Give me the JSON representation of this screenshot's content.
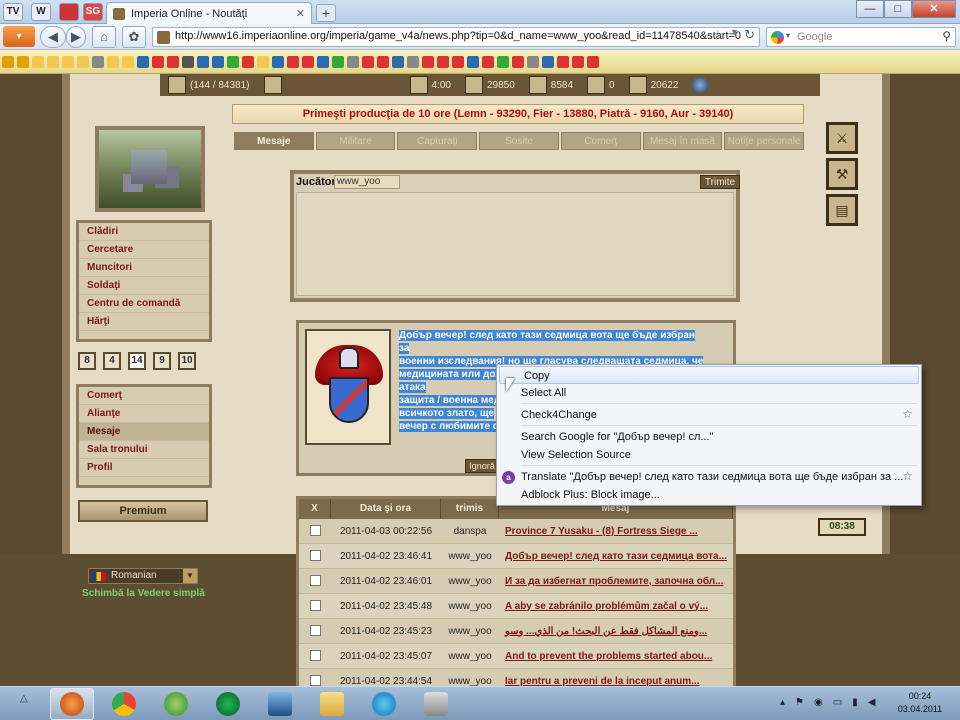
{
  "browser": {
    "pinned_tabs": [
      "TV",
      "W",
      "",
      "SG"
    ],
    "tab_title": "Imperia Online - Noutăţi",
    "new_tab": "+",
    "url": "http://www16.imperiaonline.org/imperia/game_v4a/news.php?tip=0&d_name=www_yoo&read_id=11478540&start=0",
    "search_placeholder": "Google",
    "window_controls": {
      "min": "—",
      "max": "□",
      "close": "✕"
    }
  },
  "game": {
    "resources": {
      "population": "(144 / 84381)",
      "time": "4:00",
      "r1": "29850",
      "r2": "8584",
      "r3": "0",
      "r4": "20622"
    },
    "production_banner": "Primeşti producţia de 10 ore (Lemn - 93290, Fier - 13880, Piatră - 9160, Aur - 39140)",
    "tabs": [
      "Mesaje",
      "Militare",
      "Capturaţi",
      "Sosite",
      "Comerţ",
      "Mesaj în masă",
      "Notiţe personale"
    ],
    "menu_main": [
      "Clădiri",
      "Cercetare",
      "Muncitori",
      "Soldaţi",
      "Centru de comandă",
      "Hărţi"
    ],
    "zoom_levels": [
      "8",
      "4",
      "14",
      "9",
      "10"
    ],
    "menu_secondary": [
      "Comerţ",
      "Alianţe",
      "Mesaje",
      "Sala tronului",
      "Profil"
    ],
    "premium_label": "Premium",
    "language": "Romanian",
    "switch_view": "Schimbă la  Vedere simplă",
    "clock": "08:38",
    "compose": {
      "player_label": "Jucător",
      "player_value": "www_yoo",
      "send_label": "Trimite"
    },
    "message_lines": [
      "Добър вечер! след като тази седмица вота ще бъде избран за",
      "военни изследвания! но ще гласува следващата седмица, че",
      "медицината или доходи! 24:00 след мача! Аз ще разследва атака",
      "защита / военна мед",
      "всичкото злато, ще",
      "вечер с любимите с"
    ],
    "ignore_label": "Ignoră",
    "table": {
      "headers": [
        "X",
        "Data şi ora",
        "trimis",
        "Mesaj"
      ],
      "rows": [
        {
          "date": "2011-04-03 00:22:56",
          "from": "danspa",
          "msg": "Province 7 Yusaku - (8) Fortress Siege ..."
        },
        {
          "date": "2011-04-02 23:46:41",
          "from": "www_yoo",
          "msg": "Добър вечер! след като тази седмица вота..."
        },
        {
          "date": "2011-04-02 23:46:01",
          "from": "www_yoo",
          "msg": "И за да избегнат проблемите, започна обл..."
        },
        {
          "date": "2011-04-02 23:45:48",
          "from": "www_yoo",
          "msg": "A aby se zabránilo problémům začal o vý..."
        },
        {
          "date": "2011-04-02 23:45:23",
          "from": "www_yoo",
          "msg": "ومنع المشاكل فقط عن البحث! من الذي... وسو..."
        },
        {
          "date": "2011-04-02 23:45:07",
          "from": "www_yoo",
          "msg": "And to prevent the problems started abou..."
        },
        {
          "date": "2011-04-02 23:44:54",
          "from": "www_yoo",
          "msg": "Iar pentru a preveni de la inceput anum..."
        }
      ]
    }
  },
  "context_menu": {
    "copy": "Copy",
    "select_all": "Select All",
    "check4change": "Check4Change",
    "search_google": "Search Google for \"Добър вечер! сл...\"",
    "view_source": "View Selection Source",
    "translate": "Translate \"Добър вечер! след като тази седмица вота ще бъде избран за ...",
    "adblock": "Adblock Plus: Block image..."
  },
  "taskbar": {
    "time": "00:24",
    "date": "03.04.2011"
  }
}
